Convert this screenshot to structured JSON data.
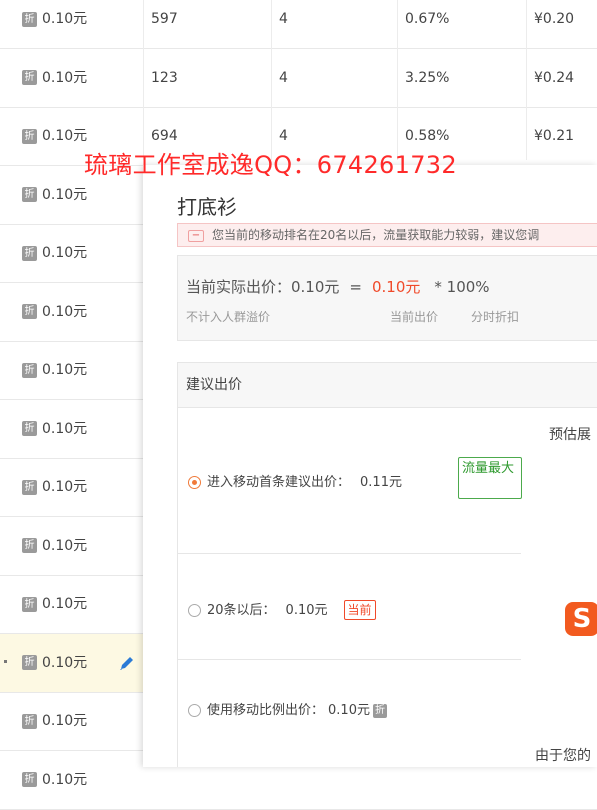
{
  "table": {
    "rows": [
      {
        "bid": "0.10元",
        "col2": "597",
        "col3": "4",
        "col4": "0.67%",
        "col5": "¥0.20"
      },
      {
        "bid": "0.10元",
        "col2": "123",
        "col3": "4",
        "col4": "3.25%",
        "col5": "¥0.24"
      },
      {
        "bid": "0.10元",
        "col2": "694",
        "col3": "4",
        "col4": "0.58%",
        "col5": "¥0.21"
      },
      {
        "bid": "0.10元"
      },
      {
        "bid": "0.10元"
      },
      {
        "bid": "0.10元"
      },
      {
        "bid": "0.10元"
      },
      {
        "bid": "0.10元"
      },
      {
        "bid": "0.10元"
      },
      {
        "bid": "0.10元"
      },
      {
        "bid": "0.10元"
      },
      {
        "bid": "0.10元",
        "highlighted": true
      },
      {
        "bid": "0.10元"
      },
      {
        "bid": "0.10元"
      }
    ],
    "discount_icon_text": "折",
    "edit_icon": "pencil-icon"
  },
  "watermark": "琉璃工作室成逸QQ：674261732",
  "panel": {
    "title": "打底衫",
    "notice": "您当前的移动排名在20名以后，流量获取能力较弱，建议您调",
    "price_summary": {
      "label": "当前实际出价：0.10元",
      "equals": "=",
      "current_bid": "0.10元",
      "multiplier": "* 100%",
      "sub_left": "不计入人群溢价",
      "sub_mid": "当前出价",
      "sub_right": "分时折扣"
    },
    "suggest": {
      "header": "建议出价",
      "estimate_label": "预估展",
      "options": [
        {
          "label": "进入移动首条建议出价：",
          "price": "0.11元",
          "tag": "流量最大",
          "selected": true
        },
        {
          "label": "20条以后：",
          "price": "0.10元",
          "tag": "当前",
          "selected": false
        },
        {
          "label": "使用移动比例出价：",
          "price": "0.10元",
          "selected": false
        }
      ],
      "footer_text": "由于您的"
    },
    "colors": {
      "accent": "#f04a2a",
      "green": "#4caa4c",
      "watermark": "#ff2a2a"
    }
  }
}
